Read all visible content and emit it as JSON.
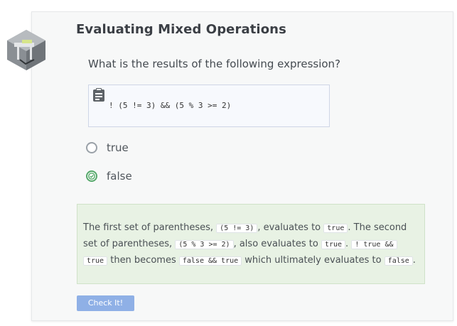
{
  "page": {
    "title": "Evaluating Mixed Operations",
    "question": "What is the results of the following expression?",
    "code": "! (5 != 3) && (5 % 3 >= 2)",
    "logo_icon": "codio-bench-logo-icon",
    "clipboard_icon": "clipboard-icon"
  },
  "options": [
    {
      "label": "true",
      "selected": false
    },
    {
      "label": "false",
      "selected": true
    }
  ],
  "feedback": {
    "t1": "The first set of parentheses, ",
    "c1": "(5 != 3)",
    "t2": ", evaluates to ",
    "c2": "true",
    "t3": ". The second",
    "t4": "set of parentheses, ",
    "c3": "(5 % 3 >= 2)",
    "t5": ", also evaluates to ",
    "c4": "true",
    "t6": ". ",
    "c5a": "! true &&",
    "c5b": "true",
    "t7": " then becomes ",
    "c6": "false && true",
    "t8": " which ultimately evaluates to ",
    "c7": "false",
    "t9": "."
  },
  "button": {
    "label": "Check It!"
  },
  "colors": {
    "accent": "#8fb0e6",
    "correct": "#55a86a",
    "feedback_bg": "#e8f2e4"
  }
}
